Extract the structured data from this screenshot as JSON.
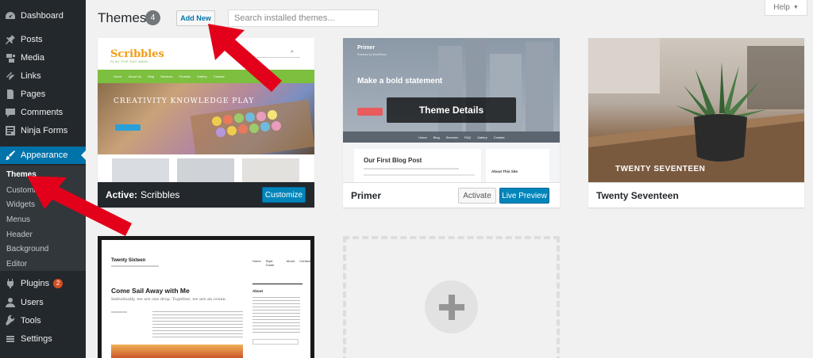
{
  "sidebar": {
    "items": [
      {
        "label": "Dashboard",
        "icon": "dashboard-icon"
      },
      {
        "label": "Posts",
        "icon": "pin-icon"
      },
      {
        "label": "Media",
        "icon": "media-icon"
      },
      {
        "label": "Links",
        "icon": "link-icon"
      },
      {
        "label": "Pages",
        "icon": "page-icon"
      },
      {
        "label": "Comments",
        "icon": "comment-icon"
      },
      {
        "label": "Ninja Forms",
        "icon": "forms-icon"
      },
      {
        "label": "Appearance",
        "icon": "brush-icon"
      },
      {
        "label": "Plugins",
        "icon": "plugin-icon",
        "badge": "2"
      },
      {
        "label": "Users",
        "icon": "user-icon"
      },
      {
        "label": "Tools",
        "icon": "wrench-icon"
      },
      {
        "label": "Settings",
        "icon": "settings-icon"
      }
    ],
    "submenu": [
      "Themes",
      "Customize",
      "Widgets",
      "Menus",
      "Header",
      "Background",
      "Editor"
    ]
  },
  "header": {
    "title": "Themes",
    "count": "4",
    "add_new": "Add New",
    "search_placeholder": "Search installed themes...",
    "help": "Help"
  },
  "themes": {
    "scribbles": {
      "logo": "Scribbles",
      "tagline": "PLAY THE DAY AWAY",
      "nav": [
        "Home",
        "About Us",
        "Blog",
        "Services",
        "Portfolio",
        "Gallery",
        "Contact"
      ],
      "hero": "CREATIVITY KNOWLEDGE PLAY",
      "active_label": "Active:",
      "name": "Scribbles",
      "customize": "Customize"
    },
    "primer": {
      "logo": "Primer",
      "tagline": "Powered by WordPress",
      "heading": "Make a bold statement",
      "nav": [
        "Home",
        "Blog",
        "Services",
        "FAQ",
        "Gallery",
        "Contact"
      ],
      "post_title": "Our First Blog Post",
      "widget_title": "About This Site",
      "details": "Theme Details",
      "name": "Primer",
      "activate": "Activate",
      "live_preview": "Live Preview"
    },
    "seventeen": {
      "overlay": "TWENTY SEVENTEEN",
      "name": "Twenty Seventeen"
    },
    "sixteen": {
      "site_title": "Twenty Sixteen",
      "nav": [
        "Home",
        "Style Guide",
        "About",
        "Contact"
      ],
      "post_title": "Come Sail Away with Me",
      "excerpt": "Individually, we are one drop. Together, we are an ocean.",
      "widget_title": "About"
    }
  },
  "colors": {
    "sidebar": "#23282d",
    "accent": "#0073aa",
    "button": "#0085ba",
    "badge": "#d54e21",
    "arrow": "#e2001a"
  }
}
